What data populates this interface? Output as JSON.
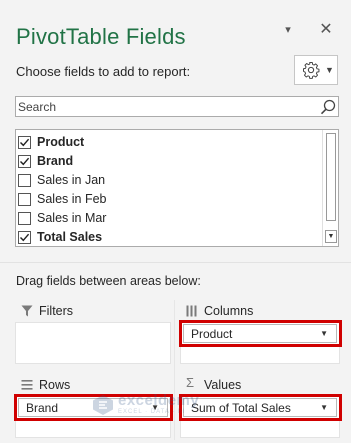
{
  "panel": {
    "title": "PivotTable Fields",
    "choose_label": "Choose fields to add to report:",
    "drag_label": "Drag fields between areas below:"
  },
  "search": {
    "placeholder": "Search",
    "value": ""
  },
  "fields": [
    {
      "label": "Product",
      "checked": true,
      "bold": true
    },
    {
      "label": "Brand",
      "checked": true,
      "bold": true
    },
    {
      "label": "Sales in Jan",
      "checked": false,
      "bold": false
    },
    {
      "label": "Sales in Feb",
      "checked": false,
      "bold": false
    },
    {
      "label": "Sales in Mar",
      "checked": false,
      "bold": false
    },
    {
      "label": "Total Sales",
      "checked": true,
      "bold": true
    }
  ],
  "areas": {
    "filters": {
      "title": "Filters",
      "icon": "filter-icon",
      "items": []
    },
    "columns": {
      "title": "Columns",
      "icon": "columns-icon",
      "items": [
        "Product"
      ]
    },
    "rows": {
      "title": "Rows",
      "icon": "rows-icon",
      "items": [
        "Brand"
      ]
    },
    "values": {
      "title": "Values",
      "icon": "sigma-icon",
      "items": [
        "Sum of Total Sales"
      ]
    }
  },
  "watermark": {
    "text": "exceldemy",
    "sub": "EXCEL · DATA · BI"
  },
  "colors": {
    "title_green": "#217346",
    "highlight_red": "#d00000",
    "pane_bg": "#f3f3f3"
  }
}
